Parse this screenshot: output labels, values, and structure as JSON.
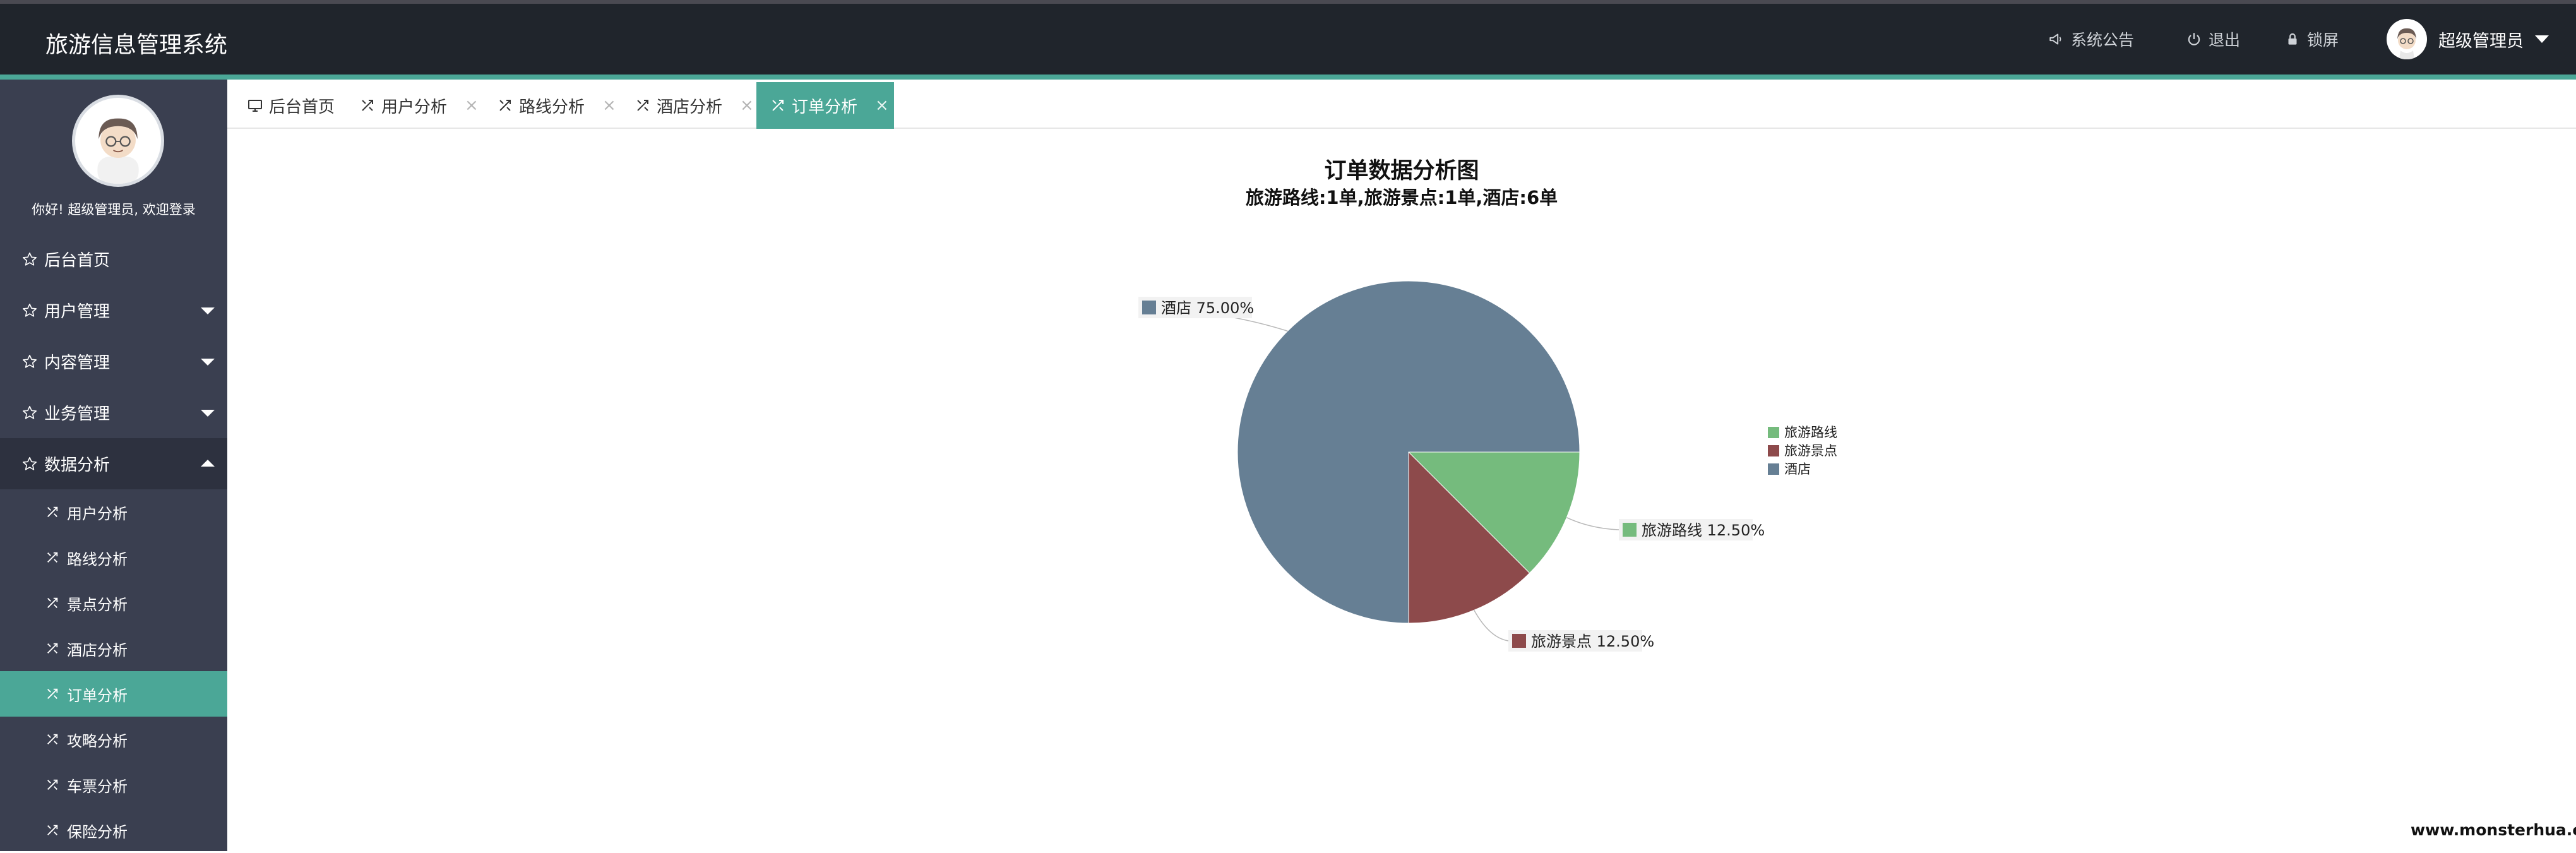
{
  "app": {
    "title": "旅游信息管理系统",
    "accent_color": "#4ba797",
    "header_color": "#20252c",
    "sidebar_color": "#3a3f50"
  },
  "header": {
    "actions": [
      {
        "label": "系统公告",
        "icon": "megaphone-icon"
      },
      {
        "label": "退出",
        "icon": "power-icon"
      },
      {
        "label": "锁屏",
        "icon": "lock-icon"
      }
    ],
    "user": {
      "name": "超级管理员",
      "icon": "avatar"
    }
  },
  "sidebar": {
    "welcome": "你好! 超级管理员, 欢迎登录",
    "menu": [
      {
        "label": "后台首页",
        "icon": "star-icon",
        "expandable": false
      },
      {
        "label": "用户管理",
        "icon": "star-icon",
        "expandable": true
      },
      {
        "label": "内容管理",
        "icon": "star-icon",
        "expandable": true
      },
      {
        "label": "业务管理",
        "icon": "star-icon",
        "expandable": true
      },
      {
        "label": "数据分析",
        "icon": "star-icon",
        "expandable": true,
        "expanded": true
      }
    ],
    "submenu": [
      {
        "label": "用户分析",
        "active": false
      },
      {
        "label": "路线分析",
        "active": false
      },
      {
        "label": "景点分析",
        "active": false
      },
      {
        "label": "酒店分析",
        "active": false
      },
      {
        "label": "订单分析",
        "active": true
      },
      {
        "label": "攻略分析",
        "active": false
      },
      {
        "label": "车票分析",
        "active": false
      },
      {
        "label": "保险分析",
        "active": false
      }
    ]
  },
  "tabs": [
    {
      "label": "后台首页",
      "icon": "monitor-icon",
      "closable": false,
      "active": false
    },
    {
      "label": "用户分析",
      "icon": "chart-tool-icon",
      "closable": true,
      "active": false
    },
    {
      "label": "路线分析",
      "icon": "chart-tool-icon",
      "closable": true,
      "active": false
    },
    {
      "label": "酒店分析",
      "icon": "chart-tool-icon",
      "closable": true,
      "active": false
    },
    {
      "label": "订单分析",
      "icon": "chart-tool-icon",
      "closable": true,
      "active": true
    }
  ],
  "chart_data": {
    "type": "pie",
    "title": "订单数据分析图",
    "subtitle": "旅游路线:1单,旅游景点:1单,酒店:6单",
    "categories": [
      "旅游路线",
      "旅游景点",
      "酒店"
    ],
    "values": [
      1,
      1,
      6
    ],
    "percent_labels": [
      "旅游路线 12.50%",
      "旅游景点 12.50%",
      "酒店 75.00%"
    ],
    "colors": [
      "#75bb7d",
      "#8d4a4b",
      "#667f94"
    ],
    "legend": "right",
    "start_angle_deg": 0
  },
  "watermark": "www.monsterhua.com"
}
